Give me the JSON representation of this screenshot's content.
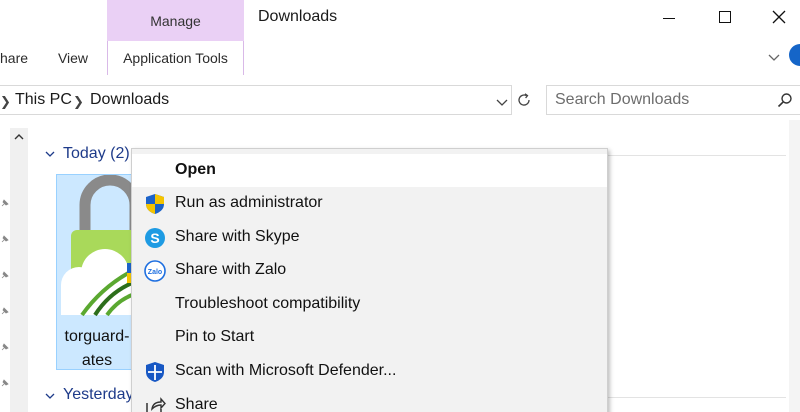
{
  "ribbon": {
    "tabs": [
      {
        "label": "hare"
      },
      {
        "label": "View"
      }
    ],
    "manage_group": "Manage",
    "app_tools_tab": "Application Tools",
    "window_title": "Downloads"
  },
  "address": {
    "crumbs": [
      "This PC",
      "Downloads"
    ],
    "search_placeholder": "Search Downloads"
  },
  "content": {
    "groups": [
      {
        "label": "Today (2)"
      },
      {
        "label": "Yesterday"
      }
    ],
    "selected_file": {
      "label_line1": "torguard-",
      "label_line2": "ates"
    }
  },
  "context_menu": {
    "items": [
      {
        "label": "Open",
        "icon": "none"
      },
      {
        "label": "Run as administrator",
        "icon": "uac-shield-icon"
      },
      {
        "label": "Share with Skype",
        "icon": "skype-icon"
      },
      {
        "label": "Share with Zalo",
        "icon": "zalo-icon"
      },
      {
        "label": "Troubleshoot compatibility",
        "icon": "none"
      },
      {
        "label": "Pin to Start",
        "icon": "none"
      },
      {
        "label": "Scan with Microsoft Defender...",
        "icon": "defender-shield-icon"
      },
      {
        "label": "Share",
        "icon": "share-icon"
      }
    ]
  },
  "colors": {
    "manage_tab": "#ead0f5",
    "selection": "#cce8ff",
    "group_heading": "#1e3b8a",
    "menu_bg": "#f2f2f2",
    "accent_blue": "#1565c8"
  }
}
